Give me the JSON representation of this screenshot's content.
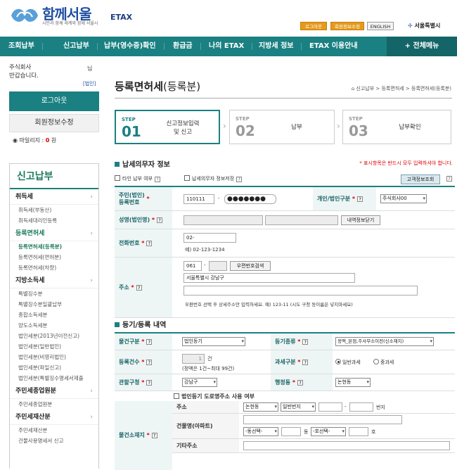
{
  "header": {
    "logo_title": "함께서울",
    "logo_etax": "ETAX",
    "logo_sub": "시민과 함께 세계와 함께 서울시",
    "logout_btn": "로그아웃",
    "member_btn": "회원정보수정",
    "english_btn": "ENGLISH",
    "seoul_label": "서울특별시"
  },
  "nav": {
    "items": [
      "조회납부",
      "신고납부",
      "납부(영수증)확인",
      "환급금",
      "나의 ETAX",
      "지방세 정보",
      "ETAX 이용안내"
    ],
    "all_menu": "+ 전체메뉴"
  },
  "sidebar": {
    "user_name": "주식회사",
    "user_nim": "님",
    "greeting": "반갑습니다.",
    "corp_tag": "[법인]",
    "logout": "로그아웃",
    "member_edit": "회원정보수정",
    "mileage_label": "마일리지 :",
    "mileage_value": "0",
    "mileage_unit": "원",
    "menu_title": "신고납부",
    "sections": [
      {
        "label": "취득세",
        "subs": [
          "취득세(부동산)",
          "취득세대리인등록"
        ]
      },
      {
        "label": "등록면허세",
        "subs": [
          "등록면허세(등록분)",
          "등록면허세(면허분)",
          "등록면허세(차량)"
        ]
      },
      {
        "label": "지방소득세",
        "subs": [
          "특별징수분",
          "특별징수분일괄납부",
          "종합소득세분",
          "양도소득세분",
          "법인세분(2013년이전신고)",
          "법인세분(일반법인)",
          "법인세분(비영리법인)",
          "법인세분(파일신고)",
          "법인세분(특별징수명세서제출"
        ]
      },
      {
        "label": "주민세종업원분",
        "subs": [
          "주민세종업원분"
        ]
      },
      {
        "label": "주민세재산분",
        "subs": [
          "주민세재산분",
          "건물사용명세서 신고"
        ]
      }
    ]
  },
  "main": {
    "title": "등록면허세",
    "title_suffix": "(등록분)",
    "breadcrumb": "신고납부 > 등록면허세 > 등록면허세(등록분)",
    "steps": [
      {
        "label": "STEP",
        "num": "01",
        "text": "신고정보입력\n및 신고"
      },
      {
        "label": "STEP",
        "num": "02",
        "text": "납부"
      },
      {
        "label": "STEP",
        "num": "03",
        "text": "납부확인"
      }
    ],
    "taxpayer_section": "납세의무자 정보",
    "required_note": "* 표시항목은 반드시 모두 입력하셔야 합니다.",
    "other_payment": "타인 납부 여부",
    "save_info": "납세의무자 정보저장",
    "customer_lookup": "고객정보조회",
    "reg_no_label": "주민(법인)\n등록번호",
    "reg_no_front": "110111",
    "reg_no_back": "●●●●●●●",
    "person_type_label": "개인/법인구분",
    "person_type_value": "주식회사00",
    "name_label": "성명(법인명)",
    "detail_btn": "내역정보닫기",
    "phone_label": "전화번호",
    "phone_value": "02-",
    "phone_example": "예) 02-123-1234",
    "address_label": "주소",
    "zip_front": "061",
    "zip_back": "",
    "zip_search_btn": "우편번호검색",
    "address_value": "서울특별시 강남구",
    "address_note": "우편번호 선택 후 상세주소만 입력하세요. 예) 123-11 (시도 구청 동이름은 넣지마세요)",
    "registration_section": "등기/등록 내역",
    "item_type_label": "물건구분",
    "item_type_value": "법인등기",
    "reg_type_label": "등기종류",
    "reg_type_value": "정액_본점,주사무소이전(신소재지)",
    "reg_count_label": "등록건수",
    "reg_count_value": "1",
    "reg_count_unit": "건",
    "reg_count_note": "(정액은 1건~최대 99건)",
    "tax_type_label": "과세구분",
    "tax_type_options": [
      "일반과세",
      "중과세"
    ],
    "office_label": "관할구청",
    "office_value": "강남구",
    "dong_label": "행정동",
    "dong_value": "논현동",
    "road_address_check": "법인등기 도로명주소 사용 여부",
    "location_label": "물건소재지",
    "loc_addr_label": "주소",
    "loc_dong": "논현동",
    "loc_bunji": "일반번지",
    "loc_bunji_unit": "번지",
    "loc_building_label": "건물명(아파트)",
    "loc_dong_select": "-동선택-",
    "loc_dong_unit": "동",
    "loc_ho_select": "-호선택-",
    "loc_ho_unit": "호",
    "loc_other_label": "기타주소"
  },
  "colors": {
    "primary": "#1b8082",
    "accent": "#e59a1e",
    "required": "#dd0000"
  }
}
